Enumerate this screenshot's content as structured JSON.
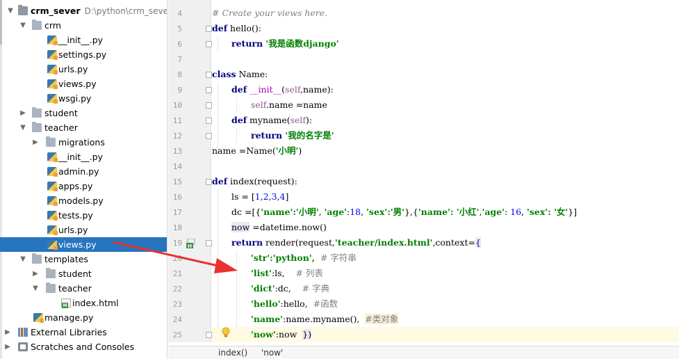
{
  "project_tree": {
    "root": {
      "name": "crm_sever",
      "path": "D:\\python\\crm_sever"
    },
    "crm_folder": "crm",
    "crm_files": [
      "__init__.py",
      "settings.py",
      "urls.py",
      "views.py",
      "wsgi.py"
    ],
    "student_folder": "student",
    "teacher_folder": "teacher",
    "migrations_folder": "migrations",
    "teacher_files": [
      "__init__.py",
      "admin.py",
      "apps.py",
      "models.py",
      "tests.py",
      "urls.py",
      "views.py"
    ],
    "templates_folder": "templates",
    "templates_student": "student",
    "templates_teacher": "teacher",
    "index_html": "index.html",
    "manage_py": "manage.py",
    "external_libraries": "External Libraries",
    "scratches": "Scratches and Consoles",
    "selected_item": "views.py"
  },
  "editor": {
    "line_numbers": [
      "4",
      "5",
      "6",
      "7",
      "8",
      "9",
      "10",
      "11",
      "12",
      "13",
      "14",
      "15",
      "16",
      "17",
      "18",
      "19",
      "20",
      "21",
      "22",
      "23",
      "24",
      "25"
    ],
    "current_line": "25",
    "lines": {
      "l4": "# Create your views here.",
      "l5_kw": "def",
      "l5_rest": " hello():",
      "l6_kw": "return",
      "l6_str": " '我是函数django'",
      "l8_kw": "class",
      "l8_rest": " Name:",
      "l9_kw": "def",
      "l9_init": "__init__",
      "l9_open": "(",
      "l9_self": "self",
      "l9_rest": ",name):",
      "l10_self": "self",
      "l10_rest": ".name =name",
      "l11_kw": "def",
      "l11_name": " myname(",
      "l11_self": "self",
      "l11_close": "):",
      "l12_kw": "return",
      "l12_str": " '我的名字是'",
      "l13_a": "name =Name(",
      "l13_str": "'小明'",
      "l13_b": ")",
      "l15_kw": "def",
      "l15_rest": " index(request):",
      "l16_a": "ls = [",
      "l16_nums": [
        "1",
        "2",
        "3",
        "4"
      ],
      "l16_b": "]",
      "l17_a": "dc =[{",
      "l17_k1": "'name'",
      "l17_v1": ":'小明'",
      "l17_k2": "'age'",
      "l17_v2": "18",
      "l17_k3": "'sex'",
      "l17_v3": ":'男'",
      "l17_mid": "},{",
      "l17_k4": "'name'",
      "l17_v4": ": '小红'",
      "l17_k5": "'age'",
      "l17_v5": "16",
      "l17_k6": "'sex'",
      "l17_v6": ": '女'",
      "l17_end": "}]",
      "l18_a": "now",
      "l18_b": " =datetime.now()",
      "l19_kw": "return",
      "l19_a": " render(request,",
      "l19_str": "'teacher/index.html'",
      "l19_b": ",context=",
      "l19_brace": "{",
      "l20_k": "'str'",
      "l20_v": ":'python',",
      "l20_c": "# 字符串",
      "l21_k": "'list'",
      "l21_v": ":ls,",
      "l21_c": "# 列表",
      "l22_k": "'dict'",
      "l22_v": ":dc,",
      "l22_c": "# 字典",
      "l23_k": "'hello'",
      "l23_v": ":hello,",
      "l23_c": "#函数",
      "l24_k": "'name'",
      "l24_v": ":name.myname(),",
      "l24_c": "#类对象",
      "l25_k": "'now'",
      "l25_v": ":now",
      "l25_end": "})"
    }
  },
  "breadcrumb": {
    "function": "index()",
    "key": "'now'"
  }
}
